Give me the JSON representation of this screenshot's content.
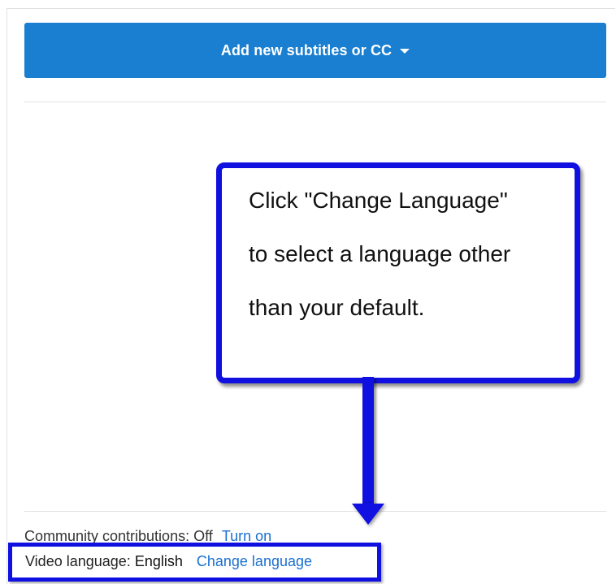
{
  "toolbar": {
    "add_subtitles_label": "Add new subtitles or CC"
  },
  "callout": {
    "line1": "Click \"Change Language\"",
    "line2": "to select a language other",
    "line3": "than your default."
  },
  "community": {
    "label": "Community contributions:",
    "status": "Off",
    "action": "Turn on"
  },
  "video_language": {
    "label": "Video language:",
    "value": "English",
    "action": "Change language"
  },
  "colors": {
    "button_blue": "#1a7fd0",
    "link_blue": "#1a6fd0",
    "annotation_blue": "#1010e0"
  }
}
